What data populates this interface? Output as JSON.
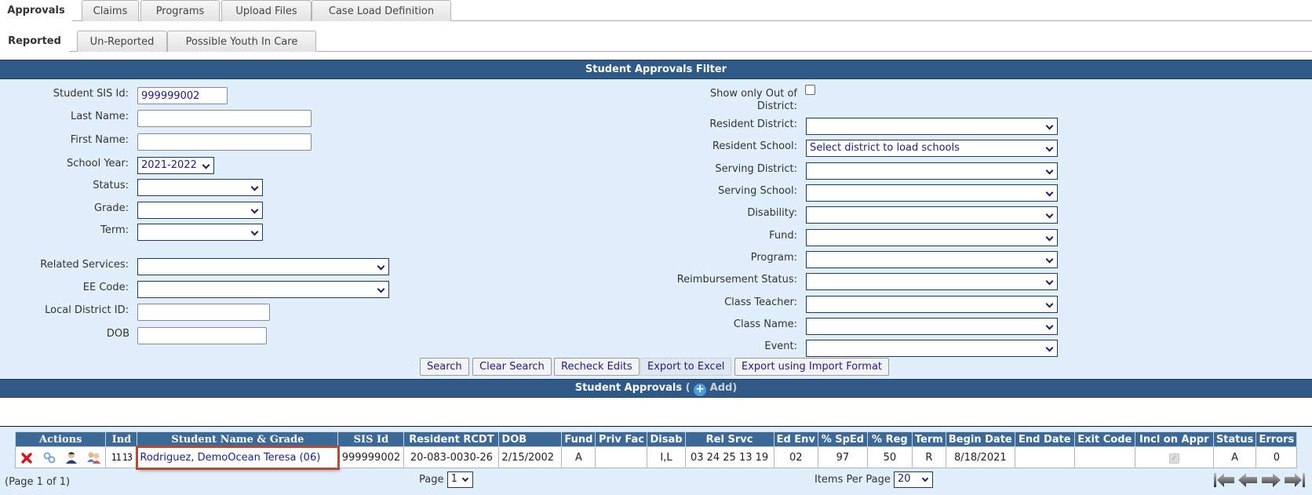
{
  "main_tabs": [
    {
      "label": "Approvals",
      "active": true
    },
    {
      "label": "Claims",
      "active": false
    },
    {
      "label": "Programs",
      "active": false
    },
    {
      "label": "Upload Files",
      "active": false
    },
    {
      "label": "Case Load Definition",
      "active": false
    }
  ],
  "sub_tabs": [
    {
      "label": "Reported",
      "active": true
    },
    {
      "label": "Un-Reported",
      "active": false
    },
    {
      "label": "Possible Youth In Care",
      "active": false
    }
  ],
  "filter": {
    "title": "Student Approvals Filter",
    "left": {
      "student_sis_id": {
        "label": "Student SIS Id:",
        "value": "999999002"
      },
      "last_name": {
        "label": "Last Name:",
        "value": ""
      },
      "first_name": {
        "label": "First Name:",
        "value": ""
      },
      "school_year": {
        "label": "School Year:",
        "value": "2021-2022"
      },
      "status": {
        "label": "Status:",
        "value": ""
      },
      "grade": {
        "label": "Grade:",
        "value": ""
      },
      "term": {
        "label": "Term:",
        "value": ""
      },
      "related_services": {
        "label": "Related Services:",
        "value": ""
      },
      "ee_code": {
        "label": "EE Code:",
        "value": ""
      },
      "local_district_id": {
        "label": "Local District ID:",
        "value": ""
      },
      "dob": {
        "label": "DOB",
        "value": ""
      }
    },
    "right": {
      "out_of_district": {
        "label_line1": "Show only Out of",
        "label_line2": "District:",
        "checked": false
      },
      "resident_district": {
        "label": "Resident District:",
        "value": ""
      },
      "resident_school": {
        "label": "Resident School:",
        "value": "Select district to load schools"
      },
      "serving_district": {
        "label": "Serving District:",
        "value": ""
      },
      "serving_school": {
        "label": "Serving School:",
        "value": ""
      },
      "disability": {
        "label": "Disability:",
        "value": ""
      },
      "fund": {
        "label": "Fund:",
        "value": ""
      },
      "program": {
        "label": "Program:",
        "value": ""
      },
      "reimbursement_status": {
        "label": "Reimbursement Status:",
        "value": ""
      },
      "class_teacher": {
        "label": "Class Teacher:",
        "value": ""
      },
      "class_name": {
        "label": "Class Name:",
        "value": ""
      },
      "event": {
        "label": "Event:",
        "value": ""
      }
    },
    "buttons": {
      "search": "Search",
      "clear_search": "Clear Search",
      "recheck_edits": "Recheck Edits",
      "export_excel": "Export to Excel",
      "export_import": "Export using Import Format"
    }
  },
  "approvals": {
    "title": "Student Approvals",
    "open_paren": "(",
    "add_label": "Add)",
    "columns": [
      "Actions",
      "Ind",
      "Student Name & Grade",
      "SIS Id",
      "Resident RCDT",
      "DOB",
      "Fund",
      "Priv Fac",
      "Disab",
      "Rel Srvc",
      "Ed Env",
      "% SpEd",
      "% Reg",
      "Term",
      "Begin Date",
      "End Date",
      "Exit Code",
      "Incl on Appr",
      "Status",
      "Errors"
    ],
    "rows": [
      {
        "actions": [
          "delete-icon",
          "link-icon",
          "user-icon",
          "users-icon"
        ],
        "ind": "11 13",
        "student": "Rodriguez, DemoOcean Teresa (06)",
        "sis_id": "999999002",
        "resident_rcdt": "20-083-0030-26",
        "dob": "2/15/2002",
        "fund": "A",
        "priv_fac": "",
        "disab": "I,L",
        "rel_srvc": "03 24 25 13 19",
        "ed_env": "02",
        "pct_sped": "97",
        "pct_reg": "50",
        "term": "R",
        "begin_date": "8/18/2021",
        "end_date": "",
        "exit_code": "",
        "incl_on_appr": true,
        "status": "A",
        "errors": "0"
      }
    ],
    "page_info": "(Page 1 of 1)",
    "page_label": "Page",
    "page_value": "1",
    "items_per_page_label": "Items Per Page",
    "items_per_page_value": "20"
  }
}
